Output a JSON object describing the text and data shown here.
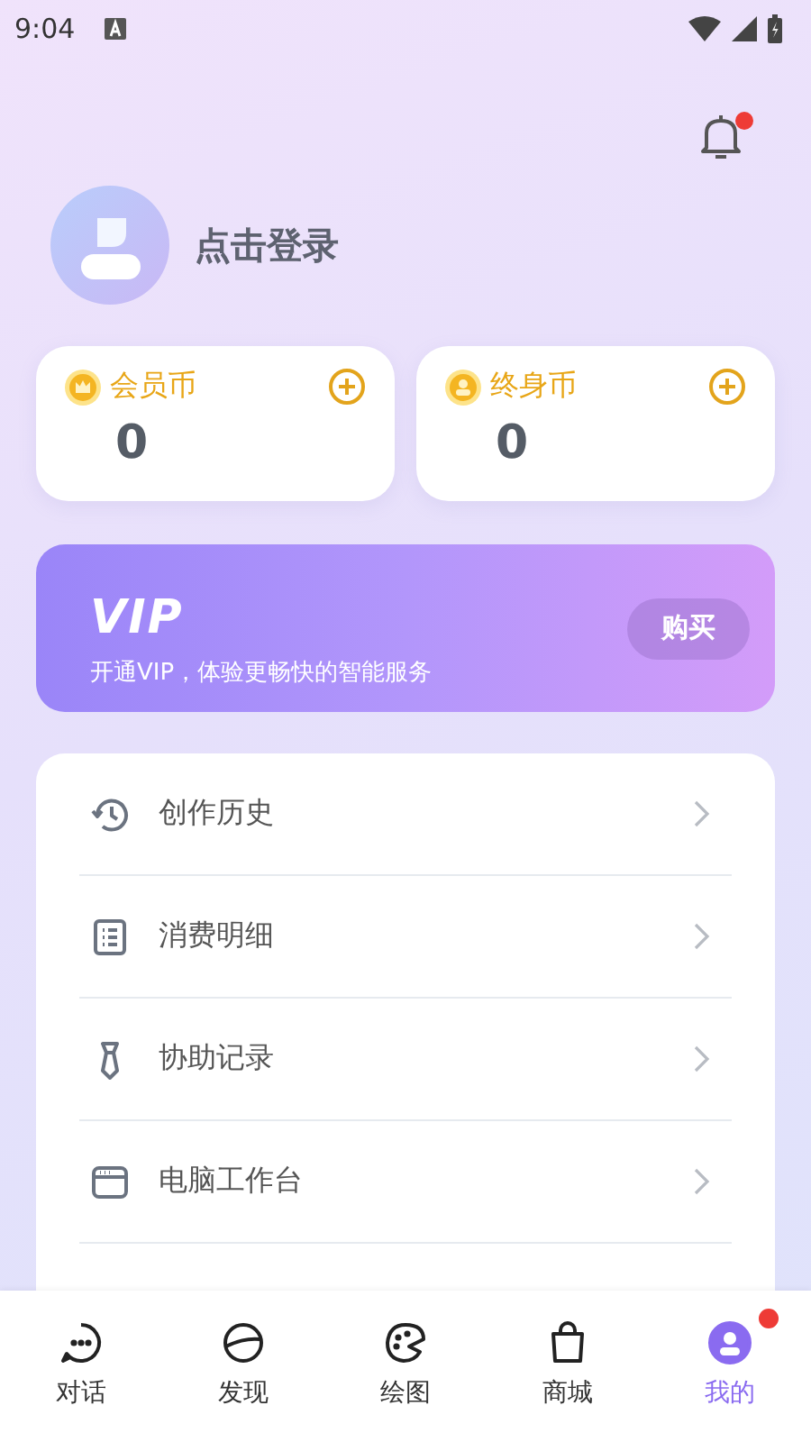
{
  "status_bar": {
    "time": "9:04"
  },
  "notifications": {
    "unread": true
  },
  "profile": {
    "login_label": "点击登录"
  },
  "wallets": [
    {
      "kind": "member",
      "label": "会员币",
      "amount": "0"
    },
    {
      "kind": "lifetime",
      "label": "终身币",
      "amount": "0"
    }
  ],
  "vip_banner": {
    "title": "VIP",
    "subtitle": "开通VIP，体验更畅快的智能服务",
    "button": "购买"
  },
  "menu": [
    {
      "kind": "history",
      "label": "创作历史"
    },
    {
      "kind": "details",
      "label": "消费明细"
    },
    {
      "kind": "tie",
      "label": "协助记录"
    },
    {
      "kind": "desktop",
      "label": "电脑工作台"
    }
  ],
  "tab_bar": [
    {
      "kind": "chat",
      "label": "对话",
      "selected": false,
      "badge": false
    },
    {
      "kind": "discover",
      "label": "发现",
      "selected": false,
      "badge": false
    },
    {
      "kind": "paint",
      "label": "绘图",
      "selected": false,
      "badge": false
    },
    {
      "kind": "shop",
      "label": "商城",
      "selected": false,
      "badge": false
    },
    {
      "kind": "me",
      "label": "我的",
      "selected": true,
      "badge": true
    }
  ]
}
